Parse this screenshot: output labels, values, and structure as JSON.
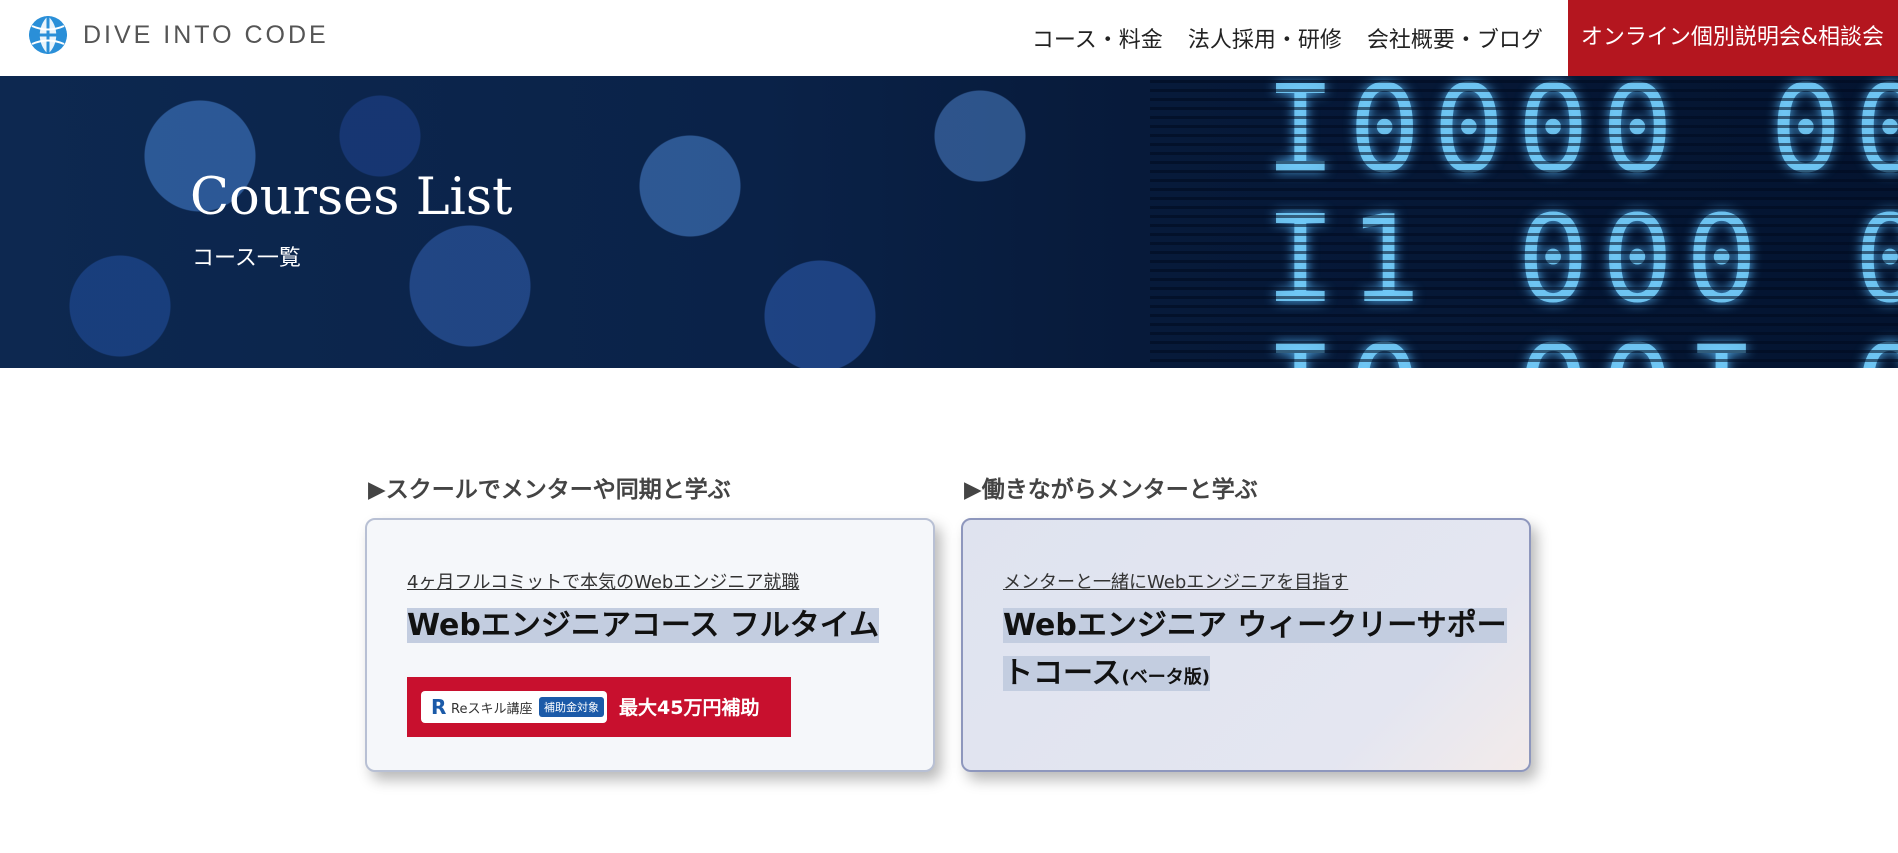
{
  "header": {
    "logo_text": "DIVE INTO CODE",
    "nav": [
      {
        "label": "コース・料金"
      },
      {
        "label": "法人採用・研修"
      },
      {
        "label": "会社概要・ブログ"
      }
    ],
    "cta_label": "オンライン個別説明会&相談会",
    "accent": "#b4161f"
  },
  "hero": {
    "title": "Courses List",
    "subtitle": "コース一覧"
  },
  "sections": [
    {
      "heading": "▶スクールでメンターや同期と学ぶ",
      "card": {
        "tagline": "4ヶ月フルコミットで本気のWebエンジニア就職",
        "name": "Webエンジニアコース フルタイム",
        "badge": {
          "logo_mark": "R",
          "logo_text": "Reスキル講座",
          "label": "補助金対象",
          "amount": "最大45万円補助"
        }
      }
    },
    {
      "heading": "▶働きながらメンターと学ぶ",
      "card": {
        "tagline": "メンターと一緒にWebエンジニアを目指す",
        "name_line1": "Webエンジニア ウィークリーサポー",
        "name_line2": "トコース",
        "name_suffix": "(ベータ版)"
      }
    }
  ]
}
